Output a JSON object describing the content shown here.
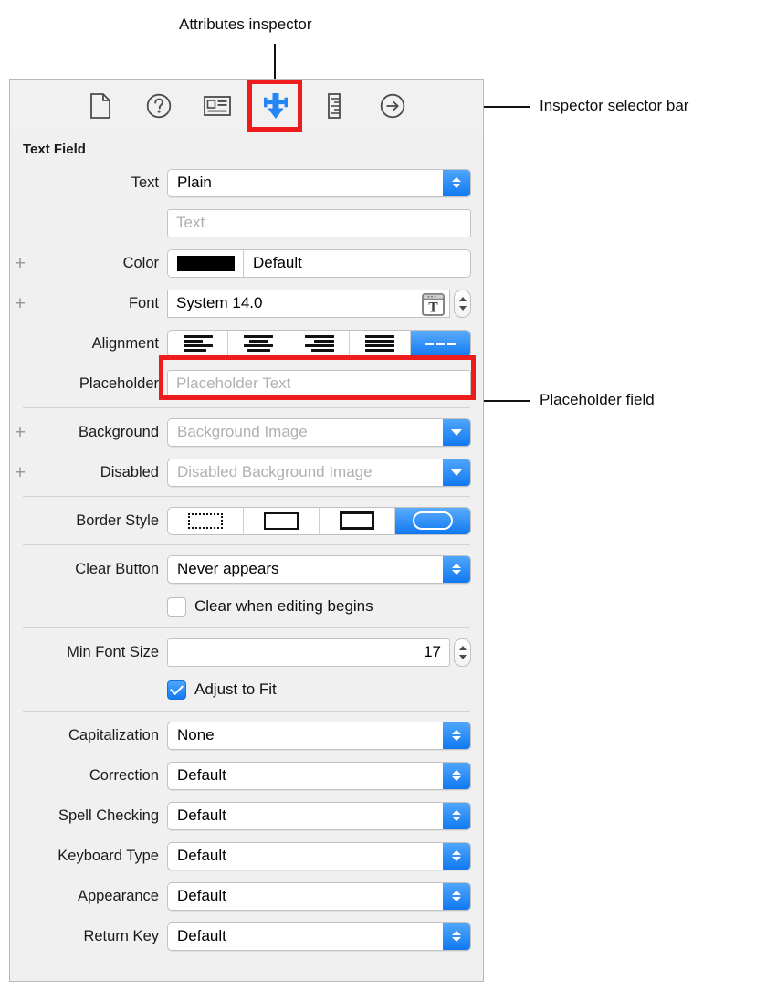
{
  "annotations": {
    "attributes_inspector": "Attributes inspector",
    "inspector_selector_bar": "Inspector selector bar",
    "placeholder_field": "Placeholder field"
  },
  "selector_bar": {
    "icons": [
      {
        "name": "file-inspector-icon",
        "label": "File inspector"
      },
      {
        "name": "quick-help-inspector-icon",
        "label": "Quick Help inspector"
      },
      {
        "name": "identity-inspector-icon",
        "label": "Identity inspector"
      },
      {
        "name": "attributes-inspector-icon",
        "label": "Attributes inspector"
      },
      {
        "name": "size-inspector-icon",
        "label": "Size inspector"
      },
      {
        "name": "connections-inspector-icon",
        "label": "Connections inspector"
      }
    ],
    "selected_index": 3,
    "highlight_color": "#ee1d1d"
  },
  "inspector": {
    "section_title": "Text Field",
    "rows": {
      "text_style": {
        "label": "Text",
        "value": "Plain"
      },
      "text_value": {
        "placeholder": "Text",
        "value": ""
      },
      "color": {
        "label": "Color",
        "value": "Default",
        "swatch": "#000000"
      },
      "font": {
        "label": "Font",
        "value": "System 14.0"
      },
      "alignment": {
        "label": "Alignment",
        "options": [
          "align-left",
          "align-center",
          "align-right",
          "align-justified",
          "align-mixed"
        ],
        "selected_index": 4
      },
      "placeholder": {
        "label": "Placeholder",
        "placeholder": "Placeholder Text",
        "value": ""
      },
      "background": {
        "label": "Background",
        "placeholder": "Background Image",
        "value": ""
      },
      "disabled": {
        "label": "Disabled",
        "placeholder": "Disabled Background Image",
        "value": ""
      },
      "border_style": {
        "label": "Border Style",
        "options": [
          "border-none-dotted",
          "border-line",
          "border-bezel",
          "border-rounded-rect"
        ],
        "selected_index": 3
      },
      "clear_button": {
        "label": "Clear Button",
        "value": "Never appears"
      },
      "clear_when_editing": {
        "label": "Clear when editing begins",
        "checked": false
      },
      "min_font_size": {
        "label": "Min Font Size",
        "value": "17"
      },
      "adjust_to_fit": {
        "label": "Adjust to Fit",
        "checked": true
      },
      "capitalization": {
        "label": "Capitalization",
        "value": "None"
      },
      "correction": {
        "label": "Correction",
        "value": "Default"
      },
      "spell_checking": {
        "label": "Spell Checking",
        "value": "Default"
      },
      "keyboard_type": {
        "label": "Keyboard Type",
        "value": "Default"
      },
      "appearance": {
        "label": "Appearance",
        "value": "Default"
      },
      "return_key": {
        "label": "Return Key",
        "value": "Default"
      }
    },
    "plus_symbol": "+",
    "accent_color": "#1179f2"
  }
}
